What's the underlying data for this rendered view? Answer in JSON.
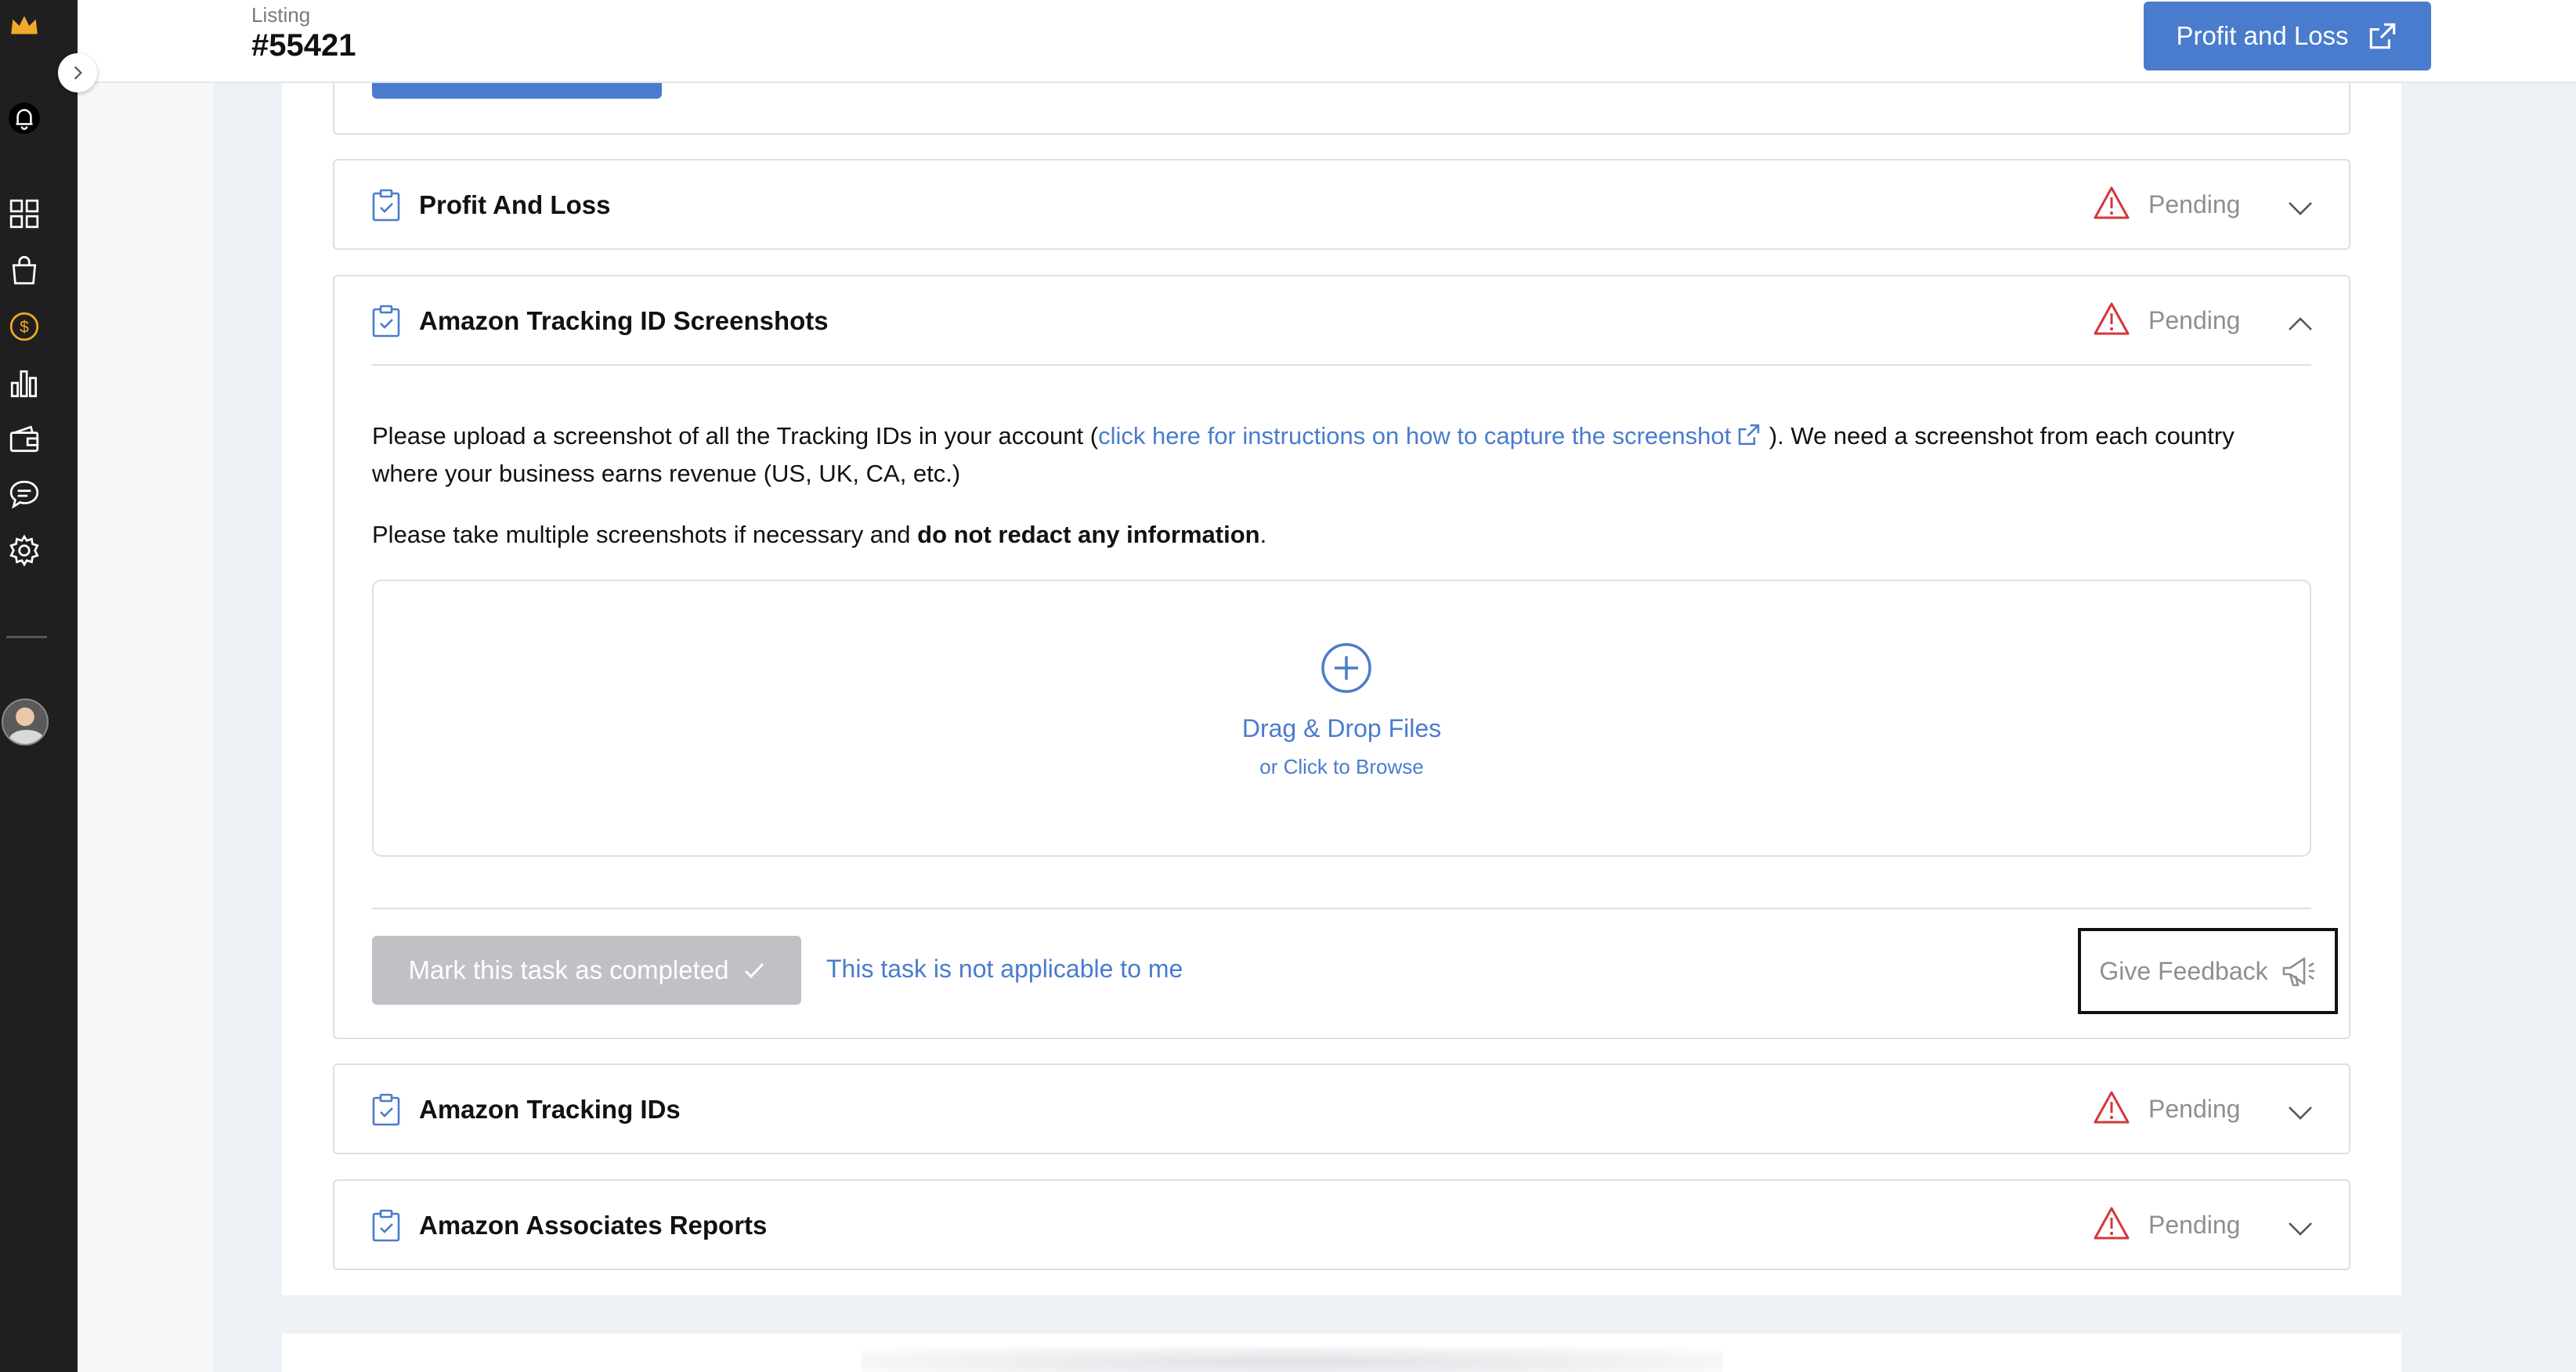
{
  "header": {
    "listing_label": "Listing",
    "listing_id": "#55421",
    "pl_button_label": "Profit and Loss"
  },
  "sidebar": {
    "icons": [
      "crown-icon",
      "bell-icon",
      "dashboard-grid-icon",
      "shopping-bag-icon",
      "dollar-icon",
      "bar-chart-icon",
      "wallet-icon",
      "chat-icon",
      "settings-icon"
    ],
    "accent_color": "#f0a92a"
  },
  "tasks": [
    {
      "title": "Profit And Loss",
      "status": "Pending",
      "expanded": false
    },
    {
      "title": "Amazon Tracking ID Screenshots",
      "status": "Pending",
      "expanded": true
    },
    {
      "title": "Amazon Tracking IDs",
      "status": "Pending",
      "expanded": false
    },
    {
      "title": "Amazon Associates Reports",
      "status": "Pending",
      "expanded": false
    }
  ],
  "expanded_task": {
    "para1_prefix": "Please upload a screenshot of all the Tracking IDs in your account (",
    "para1_link": "click here for instructions on how to capture the screenshot",
    "para1_suffix": " ). We need a screenshot from each country where your business earns revenue (US, UK, CA, etc.)",
    "para2_prefix": "Please take multiple screenshots if necessary and ",
    "para2_bold": "do not redact any information",
    "para2_suffix": ".",
    "dropzone_title": "Drag & Drop Files",
    "dropzone_sub": "or Click to Browse",
    "mark_complete_label": "Mark this task as completed",
    "not_applicable_label": "This task is not applicable to me",
    "feedback_label": "Give Feedback"
  },
  "colors": {
    "primary": "#4a7ccd",
    "warning": "#d6363b",
    "muted": "#8f8f8f",
    "sidebar_bg": "#1f1f1f"
  }
}
